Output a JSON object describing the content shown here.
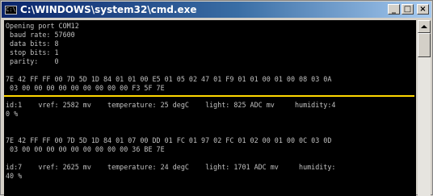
{
  "window": {
    "title": "C:\\WINDOWS\\system32\\cmd.exe",
    "icon_text": "C:\\",
    "buttons": {
      "minimize": "_",
      "maximize": "□",
      "close": "×"
    }
  },
  "console": {
    "block1": [
      "Opening port COM12",
      " baud rate: 57600",
      " data bits: 8",
      " stop bits: 1",
      " parity:    0",
      "",
      "7E 42 FF FF 00 7D 5D 1D 84 01 01 00 E5 01 05 02 47 01 F9 01 01 00 01 00 08 03 0A",
      " 03 00 00 00 00 00 00 00 00 00 F3 5F 7E"
    ],
    "block2": [
      "id:1    vref: 2582 mv    temperature: 25 degC    light: 825 ADC mv     humidity:4",
      "0 %",
      "",
      "",
      "7E 42 FF FF 00 7D 5D 1D 84 01 07 00 DD 01 FC 01 97 02 FC 01 02 00 01 00 0C 03 0D",
      " 03 00 00 00 00 00 00 00 00 00 36 BE 7E",
      "",
      "id:7    vref: 2625 mv    temperature: 24 degC    light: 1701 ADC mv     humidity:",
      "40 %"
    ]
  },
  "colors": {
    "titlebar_start": "#0a246a",
    "titlebar_end": "#a6caf0",
    "console_text": "#c0c0c0",
    "console_bg": "#000000",
    "separator": "#ffd700"
  },
  "icons": [
    "cmd-icon",
    "minimize-icon",
    "maximize-icon",
    "close-icon",
    "scroll-up-icon"
  ]
}
